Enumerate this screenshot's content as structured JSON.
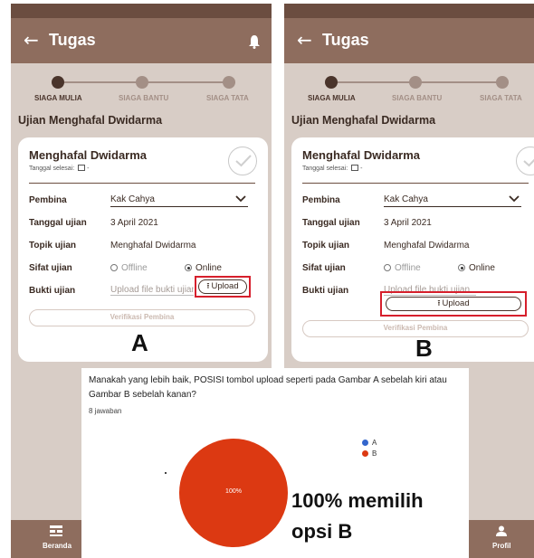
{
  "app": {
    "title": "Tugas",
    "steps": [
      "SIAGA MULIA",
      "SIAGA BANTU",
      "SIAGA TATA"
    ],
    "section_title": "Ujian Menghafal Dwidarma"
  },
  "card": {
    "title": "Menghafal Dwidarma",
    "deadline_label": "Tanggal selesai:",
    "deadline_value": "-",
    "rows": {
      "pembina_label": "Pembina",
      "pembina_value": "Kak Cahya",
      "tanggal_label": "Tanggal ujian",
      "tanggal_value": "3 April 2021",
      "topik_label": "Topik ujian",
      "topik_value": "Menghafal Dwidarma",
      "sifat_label": "Sifat ujian",
      "option_offline": "Offline",
      "option_online": "Online",
      "selected_option": "Online",
      "bukti_label": "Bukti ujian",
      "upload_placeholder": "Upload file bukti ujian"
    },
    "upload_label": "Upload",
    "verify_label": "Verifikasi Pembina"
  },
  "captions": {
    "a": "A",
    "b": "B"
  },
  "nav": {
    "home": "Beranda",
    "profile": "Profil"
  },
  "survey": {
    "question": "Manakah yang lebih baik, POSISI tombol upload seperti pada Gambar A sebelah kiri atau Gambar B sebelah kanan?",
    "responses": "8 jawaban",
    "result": "100% memilih opsi B"
  },
  "colors": {
    "header": "#8e6d5e",
    "highlight": "#d61f2c",
    "option_a": "#3366cc",
    "option_b": "#dc3912"
  },
  "chart_data": {
    "type": "pie",
    "categories": [
      "A",
      "B"
    ],
    "values": [
      0,
      100
    ],
    "slice_labels": [
      "",
      "100%"
    ],
    "legend": "right"
  }
}
